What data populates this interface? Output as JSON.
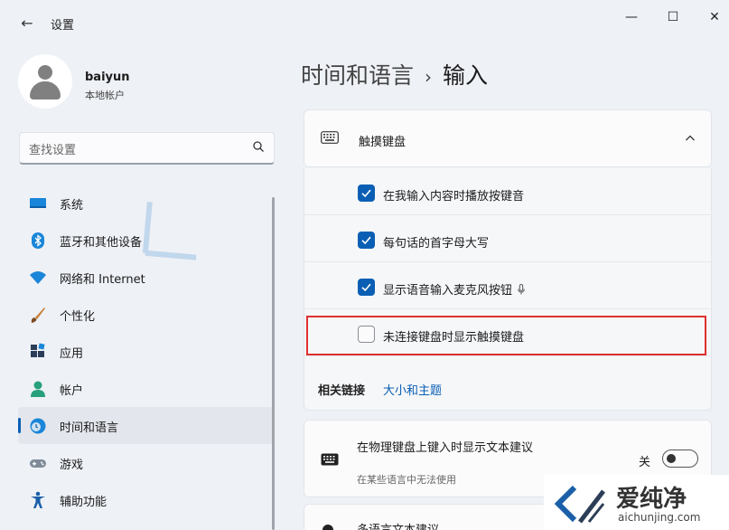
{
  "window": {
    "back_glyph": "←",
    "title": "设置",
    "minimize_glyph": "—",
    "maximize_glyph": "☐",
    "close_glyph": "✕"
  },
  "user": {
    "name": "baiyun",
    "account_type": "本地帐户"
  },
  "search": {
    "placeholder": "查找设置",
    "icon": "search-icon"
  },
  "sidebar": {
    "items": [
      {
        "label": "系统",
        "icon": "display-icon",
        "active": false
      },
      {
        "label": "蓝牙和其他设备",
        "icon": "bluetooth-icon",
        "active": false
      },
      {
        "label": "网络和 Internet",
        "icon": "wifi-icon",
        "active": false
      },
      {
        "label": "个性化",
        "icon": "brush-icon",
        "active": false
      },
      {
        "label": "应用",
        "icon": "apps-icon",
        "active": false
      },
      {
        "label": "帐户",
        "icon": "person-icon",
        "active": false
      },
      {
        "label": "时间和语言",
        "icon": "globe-clock-icon",
        "active": true
      },
      {
        "label": "游戏",
        "icon": "gamepad-icon",
        "active": false
      },
      {
        "label": "辅助功能",
        "icon": "accessibility-icon",
        "active": false
      }
    ]
  },
  "breadcrumb": {
    "parent": "时间和语言",
    "separator": "›",
    "current": "输入"
  },
  "touch_keyboard": {
    "title": "触摸键盘",
    "icon": "keyboard-icon",
    "expanded": true,
    "options": [
      {
        "label": "在我输入内容时播放按键音",
        "checked": true
      },
      {
        "label": "每句话的首字母大写",
        "checked": true
      },
      {
        "label": "显示语音输入麦克风按钮",
        "checked": true
      },
      {
        "label": "未连接键盘时显示触摸键盘",
        "checked": false
      }
    ]
  },
  "related": {
    "label": "相关链接",
    "link": "大小和主题"
  },
  "hw_suggestions": {
    "title": "在物理键盘上键入时显示文本建议",
    "subtitle": "在某些语言中无法使用",
    "toggle_label": "关",
    "toggle_on": false
  },
  "multilingual": {
    "title": "多语言文本建议"
  },
  "watermark": {
    "cn": "爱纯净",
    "en": "aichunjing.com"
  },
  "colors": {
    "accent": "#0a5fb4",
    "highlight_box": "#e03030"
  }
}
